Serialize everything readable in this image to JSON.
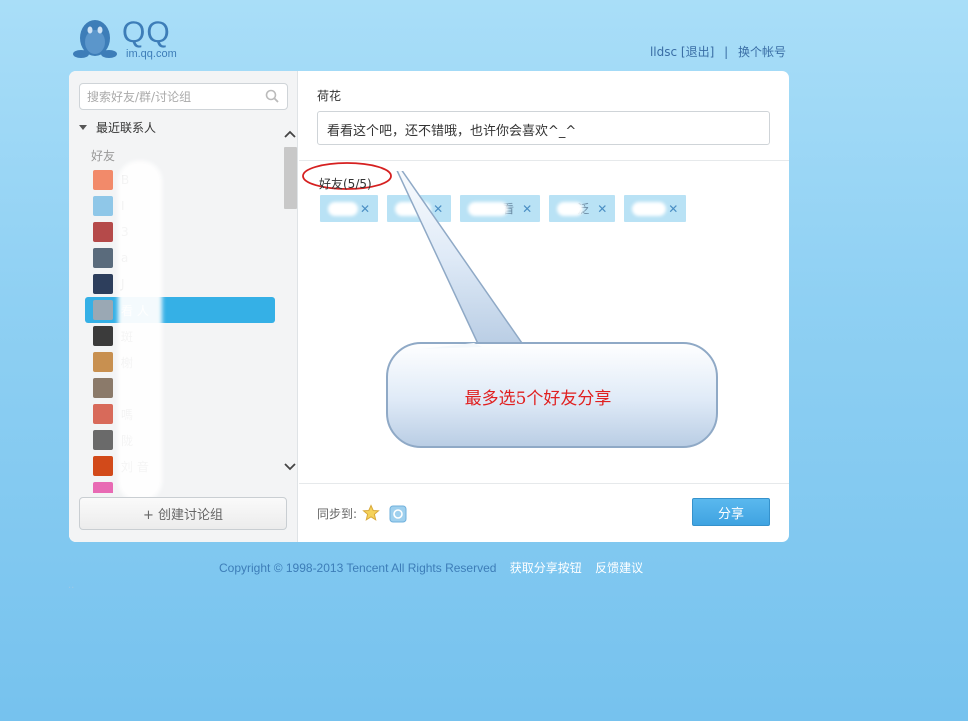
{
  "header": {
    "logo_text": "QQ",
    "logo_sub": "im.qq.com",
    "username": "lldsc",
    "logout": "[退出]",
    "separator": "|",
    "switch_account": "换个帐号"
  },
  "sidebar": {
    "search_placeholder": "搜索好友/群/讨论组",
    "recent_contacts": "最近联系人",
    "group_label": "好友",
    "friends": [
      {
        "name": "B",
        "avatar_color": "#f28a6a",
        "selected": false
      },
      {
        "name": "I",
        "avatar_color": "#8fc7e8",
        "selected": false
      },
      {
        "name": "3",
        "avatar_color": "#b54a4a",
        "selected": false
      },
      {
        "name": "a",
        "avatar_color": "#5a6b7c",
        "selected": false
      },
      {
        "name": "J",
        "avatar_color": "#2d3e5c",
        "selected": false
      },
      {
        "name": "看  人",
        "avatar_color": "#9aa8b4",
        "selected": true
      },
      {
        "name": "斑",
        "avatar_color": "#3b3b3b",
        "selected": false
      },
      {
        "name": "榭",
        "avatar_color": "#c89050",
        "selected": false
      },
      {
        "name": "",
        "avatar_color": "#8b7a6a",
        "selected": false
      },
      {
        "name": "嗎",
        "avatar_color": "#d86a5a",
        "selected": false
      },
      {
        "name": "陇",
        "avatar_color": "#6a6a6a",
        "selected": false
      },
      {
        "name": "刘  音",
        "avatar_color": "#d24a1a",
        "selected": false
      },
      {
        "name": "  ",
        "avatar_color": "#e86ab4",
        "selected": false
      }
    ],
    "create_group_button": "+ 创建讨论组"
  },
  "main": {
    "title": "荷花",
    "message": "看看这个吧，还不错哦，也许你会喜欢^_^",
    "friends_count_label": "好友(5/5)",
    "selected_friends": [
      {
        "name": "",
        "close": "✕"
      },
      {
        "name": "",
        "close": "✕"
      },
      {
        "name": "看",
        "close": "✕"
      },
      {
        "name": "泛",
        "close": "✕"
      },
      {
        "name": "",
        "close": "✕"
      }
    ],
    "callout_text": "最多选5个好友分享",
    "sync_label": "同步到:",
    "share_button": "分享"
  },
  "footer": {
    "copyright": "Copyright © 1998-2013 Tencent All Rights Reserved",
    "get_share_button": "获取分享按钮",
    "feedback": "反馈建议",
    "dots": ".."
  },
  "colors": {
    "accent": "#35b0e6",
    "chip_bg": "#b9e2f5",
    "callout_text": "#e02020",
    "brand": "#3d7db8"
  }
}
